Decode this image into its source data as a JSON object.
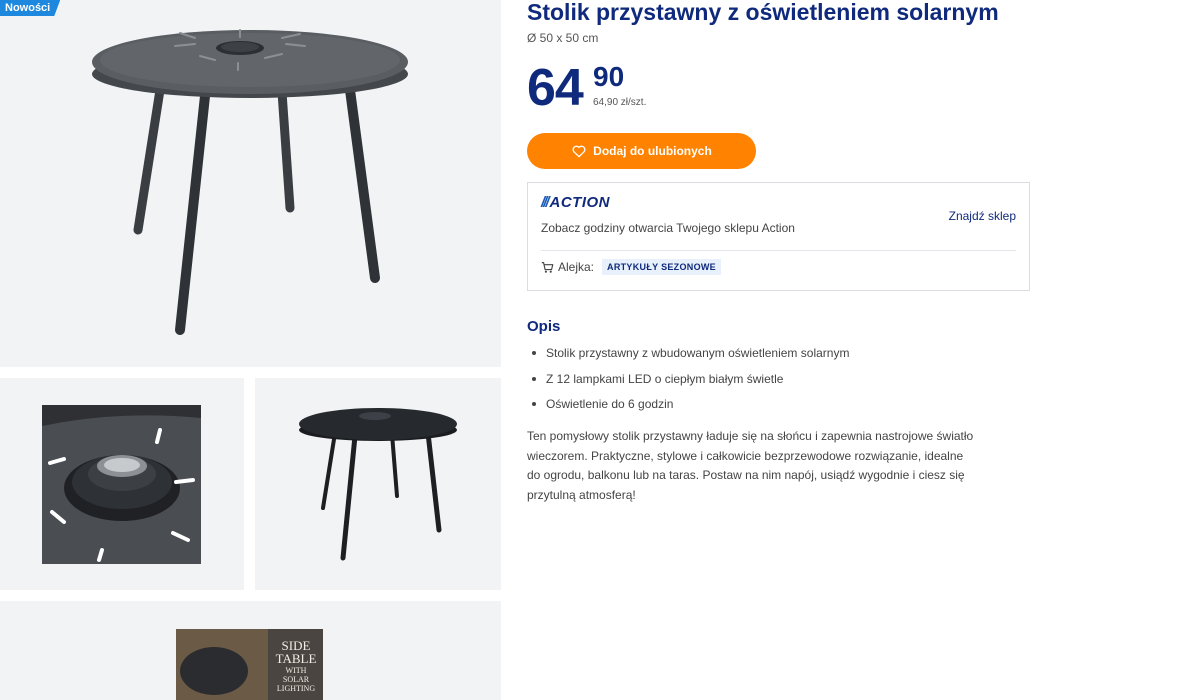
{
  "badge": {
    "label": "Nowości"
  },
  "product": {
    "title": "Stolik przystawny z oświetleniem solarnym",
    "dimensions": "Ø 50 x 50 cm"
  },
  "price": {
    "integer": "64",
    "decimal": "90",
    "unit": "64,90 zł/szt."
  },
  "favorites": {
    "label": "Dodaj do ulubionych",
    "icon": "heart-icon"
  },
  "store": {
    "logo": {
      "slashes": "///",
      "word": "ACTION"
    },
    "text": "Zobacz godziny otwarcia Twojego sklepu Action",
    "link": "Znajdź sklep",
    "aisle_label": "Alejka:",
    "aisle_value": "ARTYKUŁY SEZONOWE",
    "aisle_icon": "cart-icon"
  },
  "description": {
    "title": "Opis",
    "bullets": [
      "Stolik przystawny z wbudowanym oświetleniem solarnym",
      "Z 12 lampkami LED o ciepłym białym świetle",
      "Oświetlenie do 6 godzin"
    ],
    "body": "Ten pomysłowy stolik przystawny ładuje się na słońcu i zapewnia nastrojowe światło wieczorem. Praktyczne, stylowe i całkowicie bezprzewodowe rozwiązanie, idealne do ogrodu, balkonu lub na taras. Postaw na nim napój, usiądź wygodnie i ciesz się przytulną atmosferą!"
  },
  "packaging": {
    "line1": "SIDE",
    "line2": "TABLE",
    "line3": "WITH",
    "line4": "SOLAR",
    "line5": "LIGHTING"
  },
  "colors": {
    "brand_blue": "#0f2a7c",
    "accent_orange": "#ff8200",
    "badge_blue": "#1d88dd",
    "tile_bg": "#f1f3f5"
  }
}
